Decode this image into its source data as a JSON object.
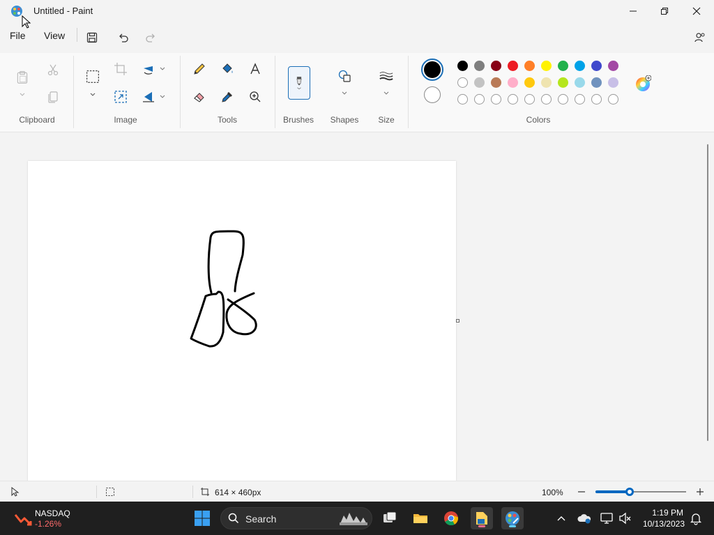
{
  "window": {
    "title": "Untitled - Paint"
  },
  "menu": {
    "file": "File",
    "view": "View"
  },
  "ribbon": {
    "groups": {
      "clipboard": "Clipboard",
      "image": "Image",
      "tools": "Tools",
      "brushes": "Brushes",
      "shapes": "Shapes",
      "size": "Size",
      "colors": "Colors"
    },
    "primary_color": "#000000",
    "secondary_color": "#ffffff",
    "palette_row1": [
      "#000000",
      "#7f7f7f",
      "#880015",
      "#ed1c24",
      "#ff7f27",
      "#fff200",
      "#22b14c",
      "#00a2e8",
      "#3f48cc",
      "#a349a4"
    ],
    "palette_row2": [
      "#ffffff",
      "#c3c3c3",
      "#b97a57",
      "#ffaec9",
      "#ffc90e",
      "#efe4b0",
      "#b5e61d",
      "#99d9ea",
      "#7092be",
      "#c8bfe7"
    ],
    "palette_row3_count_label": ""
  },
  "status": {
    "canvas_size": "614 × 460px",
    "zoom": "100%",
    "zoom_fraction": 0.38
  },
  "taskbar": {
    "stock_name": "NASDAQ",
    "stock_change": "-1.26%",
    "search_label": "Search",
    "time": "1:19 PM",
    "date": "10/13/2023"
  },
  "colors": {
    "accent": "#0067c0",
    "stock_negative": "#ff6b6b"
  }
}
